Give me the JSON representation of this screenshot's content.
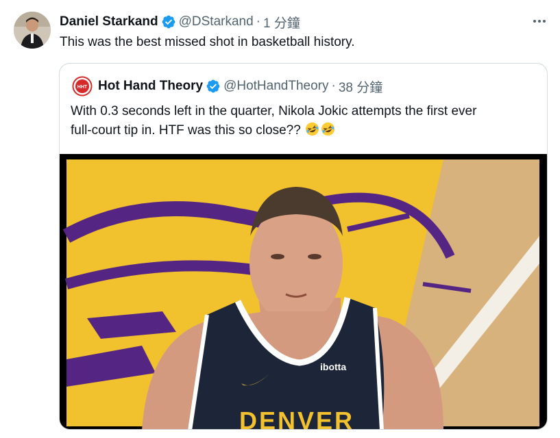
{
  "tweet": {
    "author_name": "Daniel Starkand",
    "handle": "@DStarkand",
    "separator": "·",
    "time": "1 分鐘",
    "text": "This was the best missed shot in basketball history.",
    "more_icon": "more-horizontal-icon",
    "verified_icon": "verified-badge-icon"
  },
  "quote": {
    "author_name": "Hot Hand Theory",
    "avatar_text": "HHT",
    "handle": "@HotHandTheory",
    "separator": "·",
    "time": "38 分鐘",
    "text_line1": "With 0.3 seconds left in the quarter, Nikola Jokic attempts the first ever",
    "text_line2": "full-court tip in. HTF was this so close??",
    "emoji": "🤣",
    "media": {
      "jersey_sponsor": "ibotta",
      "jersey_text": "DENVER"
    }
  },
  "colors": {
    "verified": "#1d9bf0",
    "court_yellow": "#f2c12e",
    "lakers_purple": "#552583",
    "jersey_navy": "#1d2539",
    "hht_red": "#d62a2a"
  }
}
